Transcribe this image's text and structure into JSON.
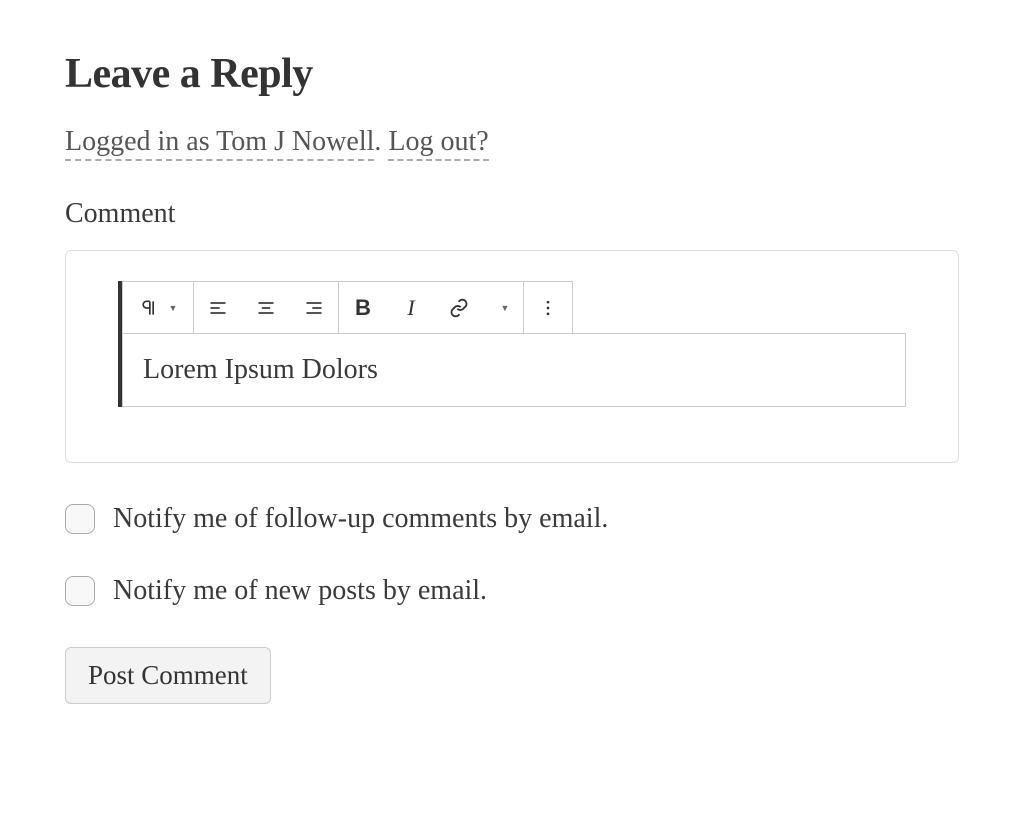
{
  "heading": "Leave a Reply",
  "login_status": {
    "prefix": "Logged in as ",
    "username": "Tom J Nowell",
    "logout_text": "Log out?"
  },
  "comment_label": "Comment",
  "editor": {
    "content": "Lorem Ipsum Dolors"
  },
  "toolbar": {
    "bold": "B",
    "italic": "I"
  },
  "checkboxes": {
    "followup": "Notify me of follow-up comments by email.",
    "newposts": "Notify me of new posts by email."
  },
  "submit_label": "Post Comment"
}
